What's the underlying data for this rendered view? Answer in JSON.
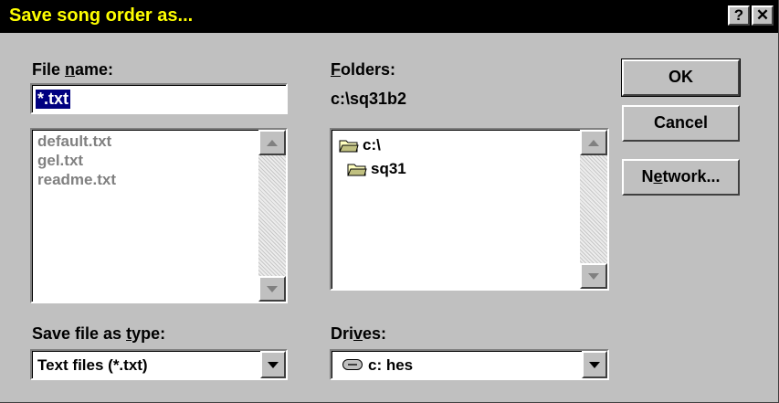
{
  "window": {
    "title": "Save song order as...",
    "help_button": "?",
    "close_button": "✕"
  },
  "file_name": {
    "label_pre": "File ",
    "label_ul": "n",
    "label_post": "ame:",
    "value": "*.txt",
    "files": [
      "default.txt",
      "gel.txt",
      "readme.txt"
    ]
  },
  "folders": {
    "label_ul": "F",
    "label_post": "olders:",
    "current_path": "c:\\sq31b2",
    "tree": [
      "c:\\",
      "sq31"
    ]
  },
  "save_type": {
    "label_pre": "Save file as ",
    "label_ul": "t",
    "label_post": "ype:",
    "value": "Text files (*.txt)"
  },
  "drives": {
    "label_pre": "Dri",
    "label_ul": "v",
    "label_post": "es:",
    "value": "c: hes"
  },
  "buttons": {
    "ok": "OK",
    "cancel": "Cancel",
    "network_pre": "N",
    "network_ul": "e",
    "network_post": "twork..."
  },
  "colors": {
    "title_bar_bg": "#000000",
    "title_text": "#ffff00",
    "dialog_bg": "#c0c0c0",
    "disabled_text": "#808080",
    "selection_bg": "#000080"
  }
}
